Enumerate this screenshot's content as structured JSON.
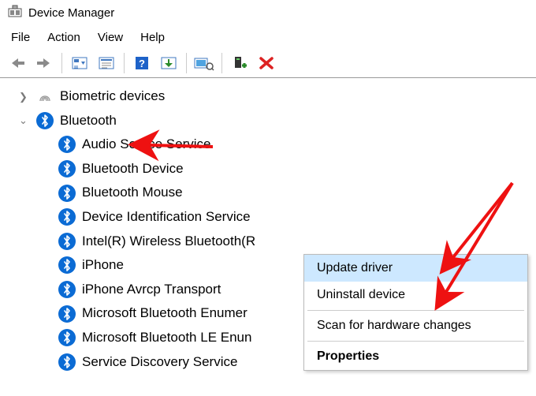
{
  "window": {
    "title": "Device Manager"
  },
  "menus": {
    "file": "File",
    "action": "Action",
    "view": "View",
    "help": "Help"
  },
  "tree": {
    "biometric": {
      "label": "Biometric devices",
      "expanded": false
    },
    "bluetooth": {
      "label": "Bluetooth",
      "expanded": true,
      "children": [
        "Audio Source Service",
        "Bluetooth Device",
        "Bluetooth Mouse",
        "Device Identification Service",
        "Intel(R) Wireless Bluetooth(R",
        "iPhone",
        "iPhone Avrcp Transport",
        "Microsoft Bluetooth Enumer",
        "Microsoft Bluetooth LE Enun",
        "Service Discovery Service"
      ]
    }
  },
  "context_menu": {
    "update": "Update driver",
    "uninstall": "Uninstall device",
    "scan": "Scan for hardware changes",
    "properties": "Properties",
    "highlighted": "update"
  },
  "icons": {
    "app": "device-manager-icon",
    "back": "back-arrow-icon",
    "forward": "forward-arrow-icon",
    "show_hidden": "show-hidden-icon",
    "properties": "properties-icon-tb",
    "help": "help-icon",
    "action": "action-icon",
    "scan": "scan-icon",
    "add": "add-device-icon",
    "remove": "remove-icon"
  }
}
